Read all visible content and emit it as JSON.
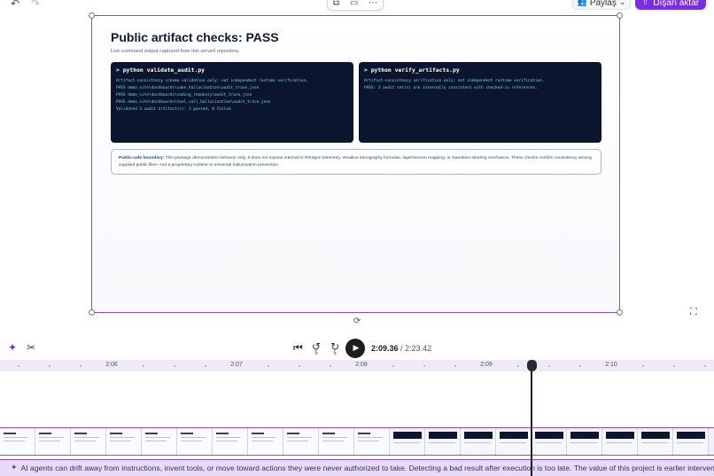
{
  "topbar": {
    "undo_icon": "undo-icon",
    "redo_icon": "redo-icon",
    "share_label": "Paylaş",
    "export_label": "Dışarı aktar"
  },
  "slide": {
    "title": "Public artifact checks: PASS",
    "subtitle": "Live command output captured from this served repository.",
    "terminals": [
      {
        "command": "> python validate_audit.py",
        "lines": [
          "Artifact-consistency schema validation only; not independent runtime verification.",
          "PASS demo_site\\dashboards\\cake_hallucination\\audit_trace.json",
          "PASS demo_site\\dashboards\\coding_readonly\\audit_trace.json",
          "PASS demo_site\\dashboards\\tool_call_hallucination\\audit_trace.json",
          "Validated 3 audit artifact(s): 3 passed, 0 failed."
        ]
      },
      {
        "command": "> python verify_artifacts.py",
        "lines": [
          "Artifact-consistency verification only; not independent runtime verification.",
          "PASS: 3 audit set(s) are internally consistent with checked-in references."
        ]
      }
    ],
    "note_label": "Public-safe boundary:",
    "note_text": " This package demonstrates behavior only. It does not expose internal AI Röntgen telemetry, Vesalius tomography formulas, layer/neuron mapping, or Daedalus steering mechanics. These checks confirm consistency among supplied public files—not a proprietary runtime or universal hallucination prevention."
  },
  "transport": {
    "current_time": "2:09.36",
    "separator": " / ",
    "total_time": "2:23.42",
    "skip_back_seconds": "5",
    "skip_forward_seconds": "5"
  },
  "timeline": {
    "ticks": [
      "2:06",
      "2:07",
      "2:08",
      "2:09",
      "2:10"
    ],
    "caption": "AI agents can drift away from instructions, invent tools, or move toward actions they were never authorized to take. Detecting a bad result after execution is too late. The value of this project is earlier intervention: expose risk"
  },
  "colors": {
    "accent": "#7a2ee0",
    "terminal_bg": "#0b1530",
    "terminal_text": "#5ae6d6"
  }
}
